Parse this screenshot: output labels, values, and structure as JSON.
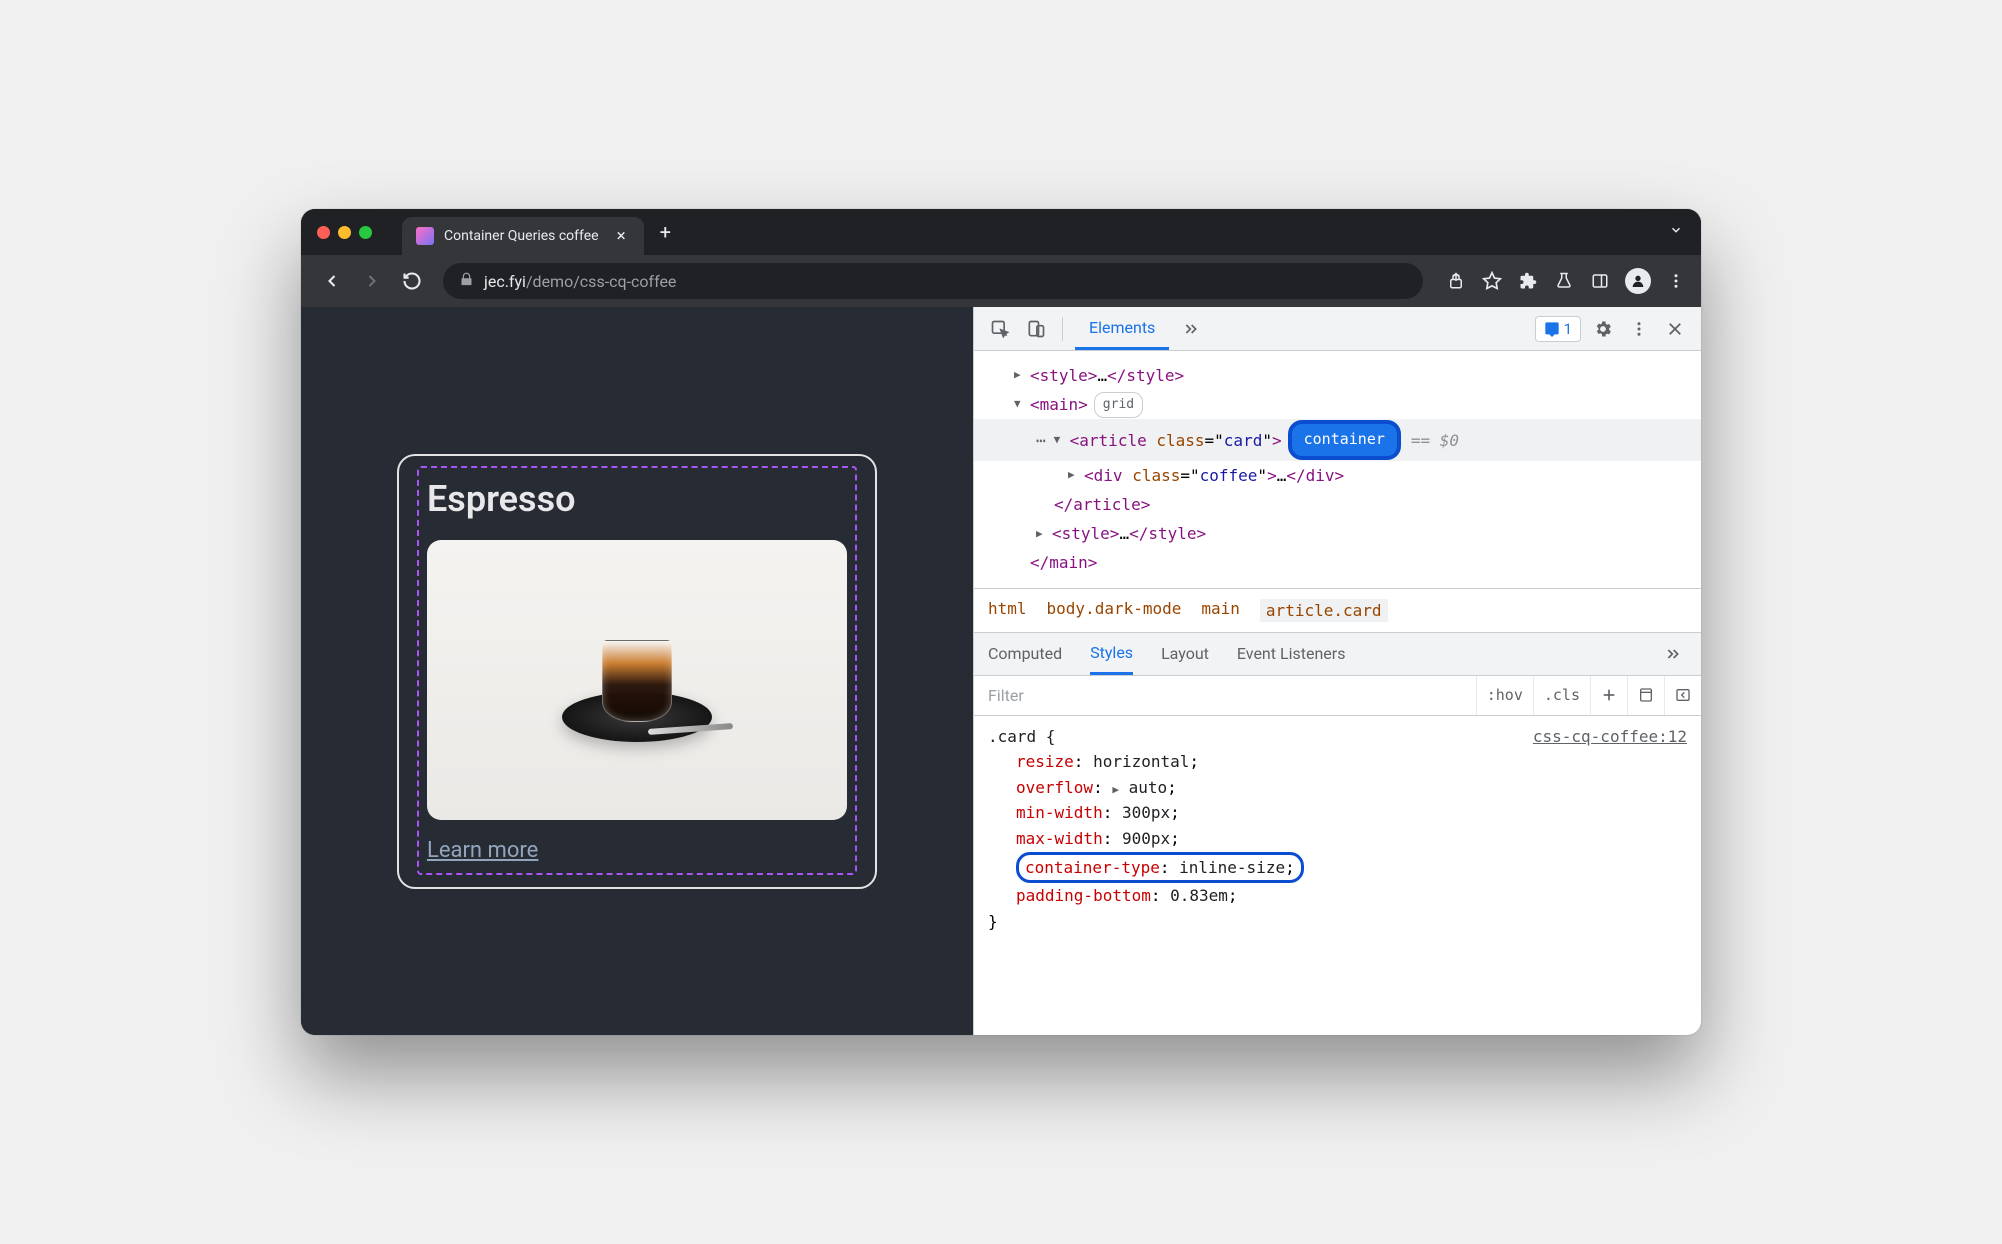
{
  "titlebar": {
    "tab_title": "Container Queries coffee"
  },
  "addressbar": {
    "host": "jec.fyi",
    "path": "/demo/css-cq-coffee"
  },
  "page": {
    "card_title": "Espresso",
    "learn_more": "Learn more"
  },
  "devtools": {
    "tabs": {
      "elements": "Elements",
      "issues_count": "1"
    },
    "dom": {
      "style_open": "<style>",
      "style_ellipsis": "…",
      "style_close": "</style>",
      "main_open": "<main>",
      "grid_badge": "grid",
      "article_open_tag": "article",
      "article_attr_name": "class",
      "article_attr_value": "card",
      "container_badge": "container",
      "eq_dollar": "== $0",
      "div_open_tag": "div",
      "div_attr_name": "class",
      "div_attr_value": "coffee",
      "div_ellipsis": "…",
      "div_close": "</div>",
      "article_close": "</article>",
      "main_close": "</main>"
    },
    "breadcrumb": {
      "html": "html",
      "body": "body.dark-mode",
      "main": "main",
      "article": "article.card"
    },
    "styles_tabs": {
      "computed": "Computed",
      "styles": "Styles",
      "layout": "Layout",
      "event_listeners": "Event Listeners"
    },
    "filter": {
      "placeholder": "Filter",
      "hov": ":hov",
      "cls": ".cls"
    },
    "css": {
      "selector": ".card {",
      "source": "css-cq-coffee:12",
      "p1_name": "resize",
      "p1_value": "horizontal",
      "p2_name": "overflow",
      "p2_value": "auto",
      "p3_name": "min-width",
      "p3_value": "300px",
      "p4_name": "max-width",
      "p4_value": "900px",
      "p5_name": "container-type",
      "p5_value": "inline-size",
      "p6_name": "padding-bottom",
      "p6_value": "0.83em",
      "close": "}"
    }
  }
}
